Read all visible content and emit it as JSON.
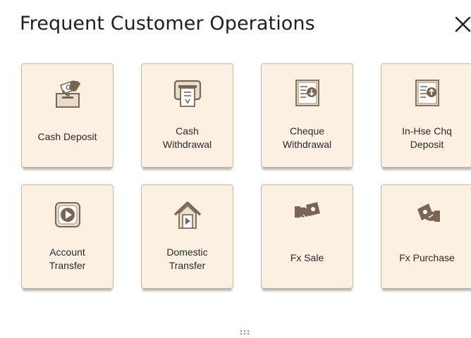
{
  "dialog": {
    "title": "Frequent Customer Operations",
    "close_icon": "close-icon"
  },
  "tiles": [
    {
      "label_lines": [
        "Cash Deposit"
      ],
      "icon": "cash-deposit-icon"
    },
    {
      "label_lines": [
        "Cash",
        "Withdrawal"
      ],
      "icon": "atm-withdrawal-icon"
    },
    {
      "label_lines": [
        "Cheque",
        "Withdrawal"
      ],
      "icon": "cheque-withdrawal-icon"
    },
    {
      "label_lines": [
        "In-Hse Chq",
        "Deposit"
      ],
      "icon": "cheque-deposit-icon"
    },
    {
      "label_lines": [
        "Account",
        "Transfer"
      ],
      "icon": "account-transfer-icon"
    },
    {
      "label_lines": [
        "Domestic",
        "Transfer"
      ],
      "icon": "domestic-transfer-icon"
    },
    {
      "label_lines": [
        "Fx Sale"
      ],
      "icon": "fx-sale-icon"
    },
    {
      "label_lines": [
        "Fx Purchase"
      ],
      "icon": "fx-purchase-icon"
    }
  ],
  "colors": {
    "tile_background": "#fcf0e2",
    "tile_border": "#c4b6a8",
    "icon_brown": "#7a6552",
    "icon_light": "#e9dccb",
    "title_text": "#1f1f1f"
  },
  "drag_handle_icon": "drag-handle-icon"
}
